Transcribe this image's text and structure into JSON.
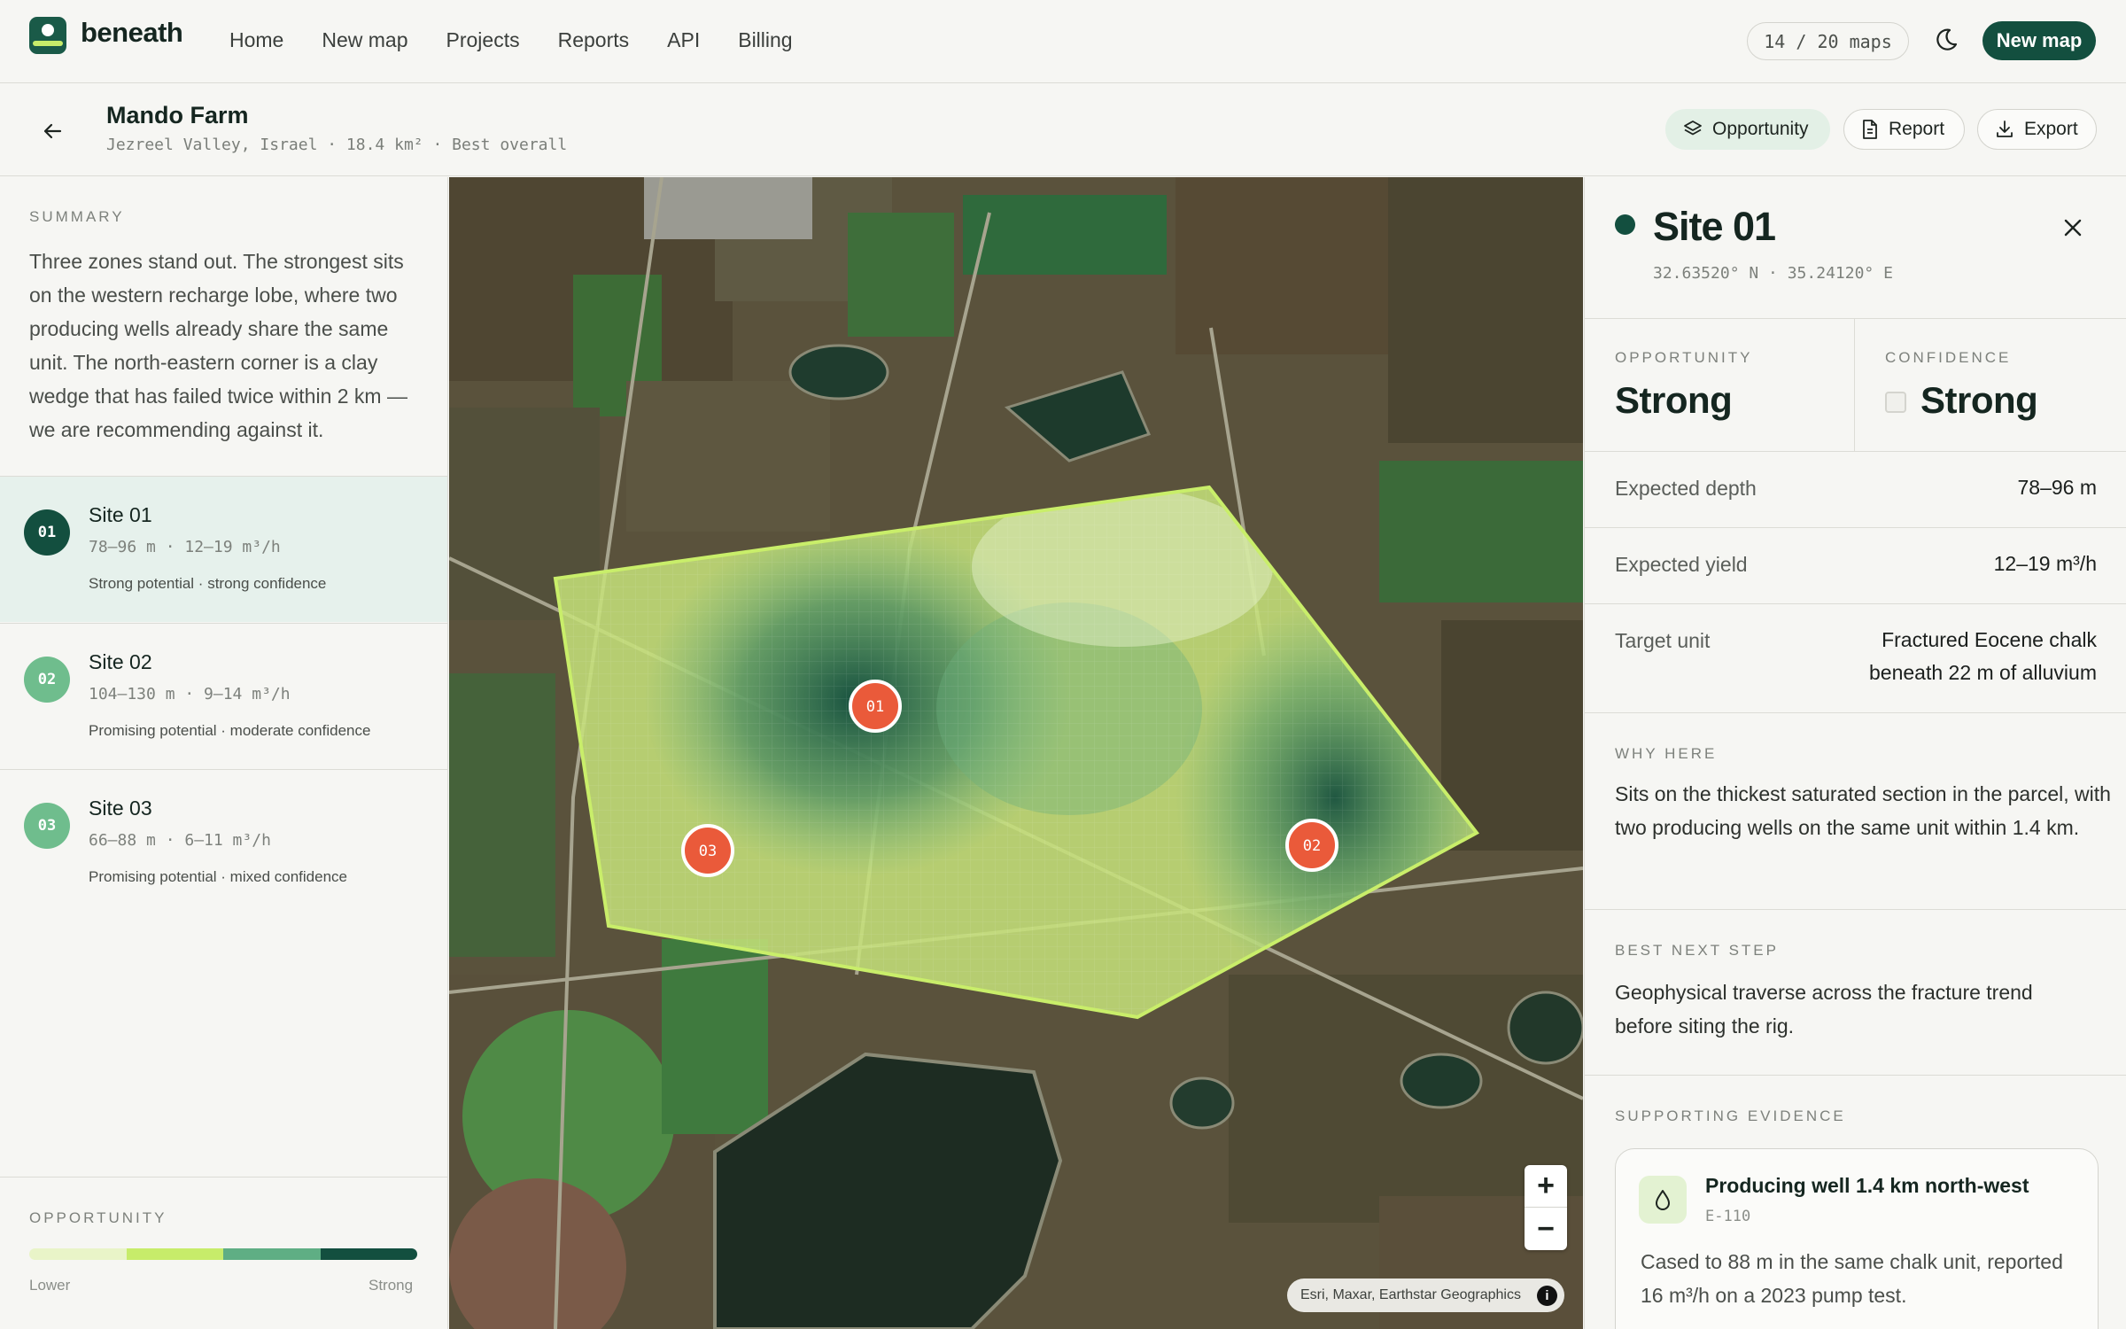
{
  "nav": {
    "brand": "beneath",
    "links": [
      "Home",
      "New map",
      "Projects",
      "Reports",
      "API",
      "Billing"
    ],
    "quota": "14 / 20 maps",
    "new_map_button": "New map"
  },
  "header": {
    "title": "Mando Farm",
    "meta": "Jezreel Valley, Israel · 18.4 km² · Best overall",
    "buttons": {
      "opportunity": "Opportunity",
      "report": "Report",
      "export": "Export"
    }
  },
  "summary": {
    "label": "SUMMARY",
    "text": "Three zones stand out. The strongest sits on the western recharge lobe, where two producing wells already share the same unit. The north-eastern corner is a clay wedge that has failed twice within 2 km — we are recommending against it."
  },
  "sites": [
    {
      "badge": "01",
      "name": "Site 01",
      "metrics": "78–96 m · 12–19 m³/h",
      "desc": "Strong potential · strong confidence",
      "color": "#134f3f"
    },
    {
      "badge": "02",
      "name": "Site 02",
      "metrics": "104–130 m · 9–14 m³/h",
      "desc": "Promising potential · moderate confidence",
      "color": "#6fbd8d"
    },
    {
      "badge": "03",
      "name": "Site 03",
      "metrics": "66–88 m · 6–11 m³/h",
      "desc": "Promising potential · mixed confidence",
      "color": "#6fbd8d"
    }
  ],
  "legend": {
    "label": "OPPORTUNITY",
    "low": "Lower",
    "high": "Strong",
    "colors": [
      "#e9f4c8",
      "#c7ec6a",
      "#5fae84",
      "#134f3f"
    ]
  },
  "map": {
    "markers": [
      "01",
      "02",
      "03"
    ],
    "marker_color": "#ea5a3a",
    "zoom_in": "+",
    "zoom_out": "−",
    "attribution": "Esri, Maxar, Earthstar Geographics",
    "info": "i"
  },
  "detail": {
    "title": "Site 01",
    "coords": "32.63520° N · 35.24120° E",
    "opportunity_label": "OPPORTUNITY",
    "opportunity_value": "Strong",
    "confidence_label": "CONFIDENCE",
    "confidence_value": "Strong",
    "rows": [
      {
        "key": "Expected depth",
        "value": "78–96 m"
      },
      {
        "key": "Expected yield",
        "value": "12–19 m³/h"
      },
      {
        "key": "Target unit",
        "value_line1": "Fractured Eocene chalk",
        "value_line2": "beneath 22 m of alluvium"
      }
    ],
    "why_label": "WHY HERE",
    "why_text": "Sits on the thickest saturated section in the parcel, with two producing wells on the same unit within 1.4 km.",
    "next_label": "BEST NEXT STEP",
    "next_text": "Geophysical traverse across the fracture trend before siting the rig.",
    "evidence_label": "SUPPORTING EVIDENCE",
    "evidence": {
      "title": "Producing well 1.4 km north-west",
      "id": "E-110",
      "text": "Cased to 88 m in the same chalk unit, reported 16 m³/h on a 2023 pump test."
    }
  }
}
